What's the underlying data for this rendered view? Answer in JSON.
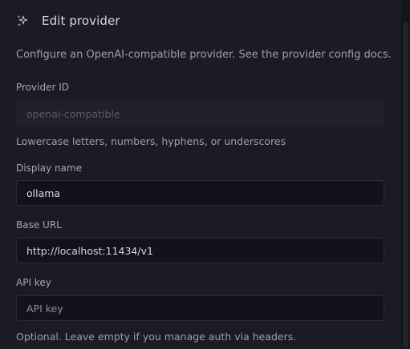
{
  "dialog": {
    "title": "Edit provider",
    "description": "Configure an OpenAI-compatible provider. See the provider config docs."
  },
  "fields": {
    "provider_id": {
      "label": "Provider ID",
      "placeholder": "openai-compatible",
      "help": "Lowercase letters, numbers, hyphens, or underscores"
    },
    "display_name": {
      "label": "Display name",
      "value": "ollama"
    },
    "base_url": {
      "label": "Base URL",
      "value": "http://localhost:11434/v1"
    },
    "api_key": {
      "label": "API key",
      "placeholder": "API key",
      "help": "Optional. Leave empty if you manage auth via headers."
    }
  },
  "icons": {
    "header_icon": "sparkles-icon"
  }
}
